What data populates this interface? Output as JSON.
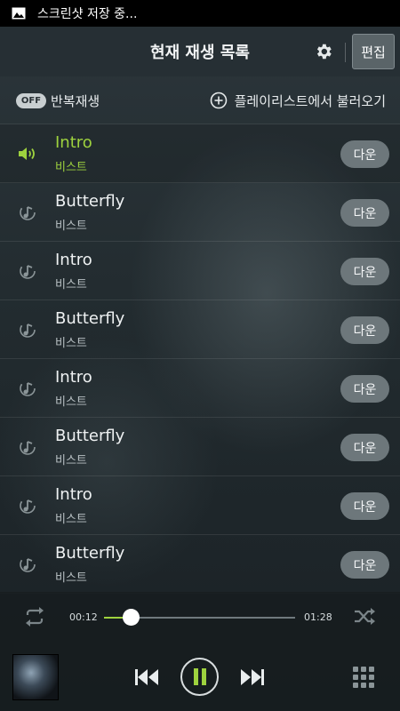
{
  "status_bar": {
    "text": "스크린샷 저장 중...",
    "icon": "image-icon"
  },
  "header": {
    "title": "현재 재생 목록",
    "edit_label": "편집",
    "settings_icon": "gear-icon"
  },
  "options": {
    "repeat_toggle": "OFF",
    "repeat_label": "반복재생",
    "load_playlist_label": "플레이리스트에서 불러오기"
  },
  "tracks": [
    {
      "title": "Intro",
      "artist": "비스트",
      "button": "다운",
      "playing": true
    },
    {
      "title": "Butterfly",
      "artist": "비스트",
      "button": "다운",
      "playing": false
    },
    {
      "title": "Intro",
      "artist": "비스트",
      "button": "다운",
      "playing": false
    },
    {
      "title": "Butterfly",
      "artist": "비스트",
      "button": "다운",
      "playing": false
    },
    {
      "title": "Intro",
      "artist": "비스트",
      "button": "다운",
      "playing": false
    },
    {
      "title": "Butterfly",
      "artist": "비스트",
      "button": "다운",
      "playing": false
    },
    {
      "title": "Intro",
      "artist": "비스트",
      "button": "다운",
      "playing": false
    },
    {
      "title": "Butterfly",
      "artist": "비스트",
      "button": "다운",
      "playing": false
    }
  ],
  "player": {
    "current_time": "00:12",
    "total_time": "01:28",
    "progress_fraction": 0.14,
    "state": "playing"
  },
  "colors": {
    "accent": "#9ed23e",
    "button_bg": "#6d777b",
    "header_bg": "#262f34"
  }
}
